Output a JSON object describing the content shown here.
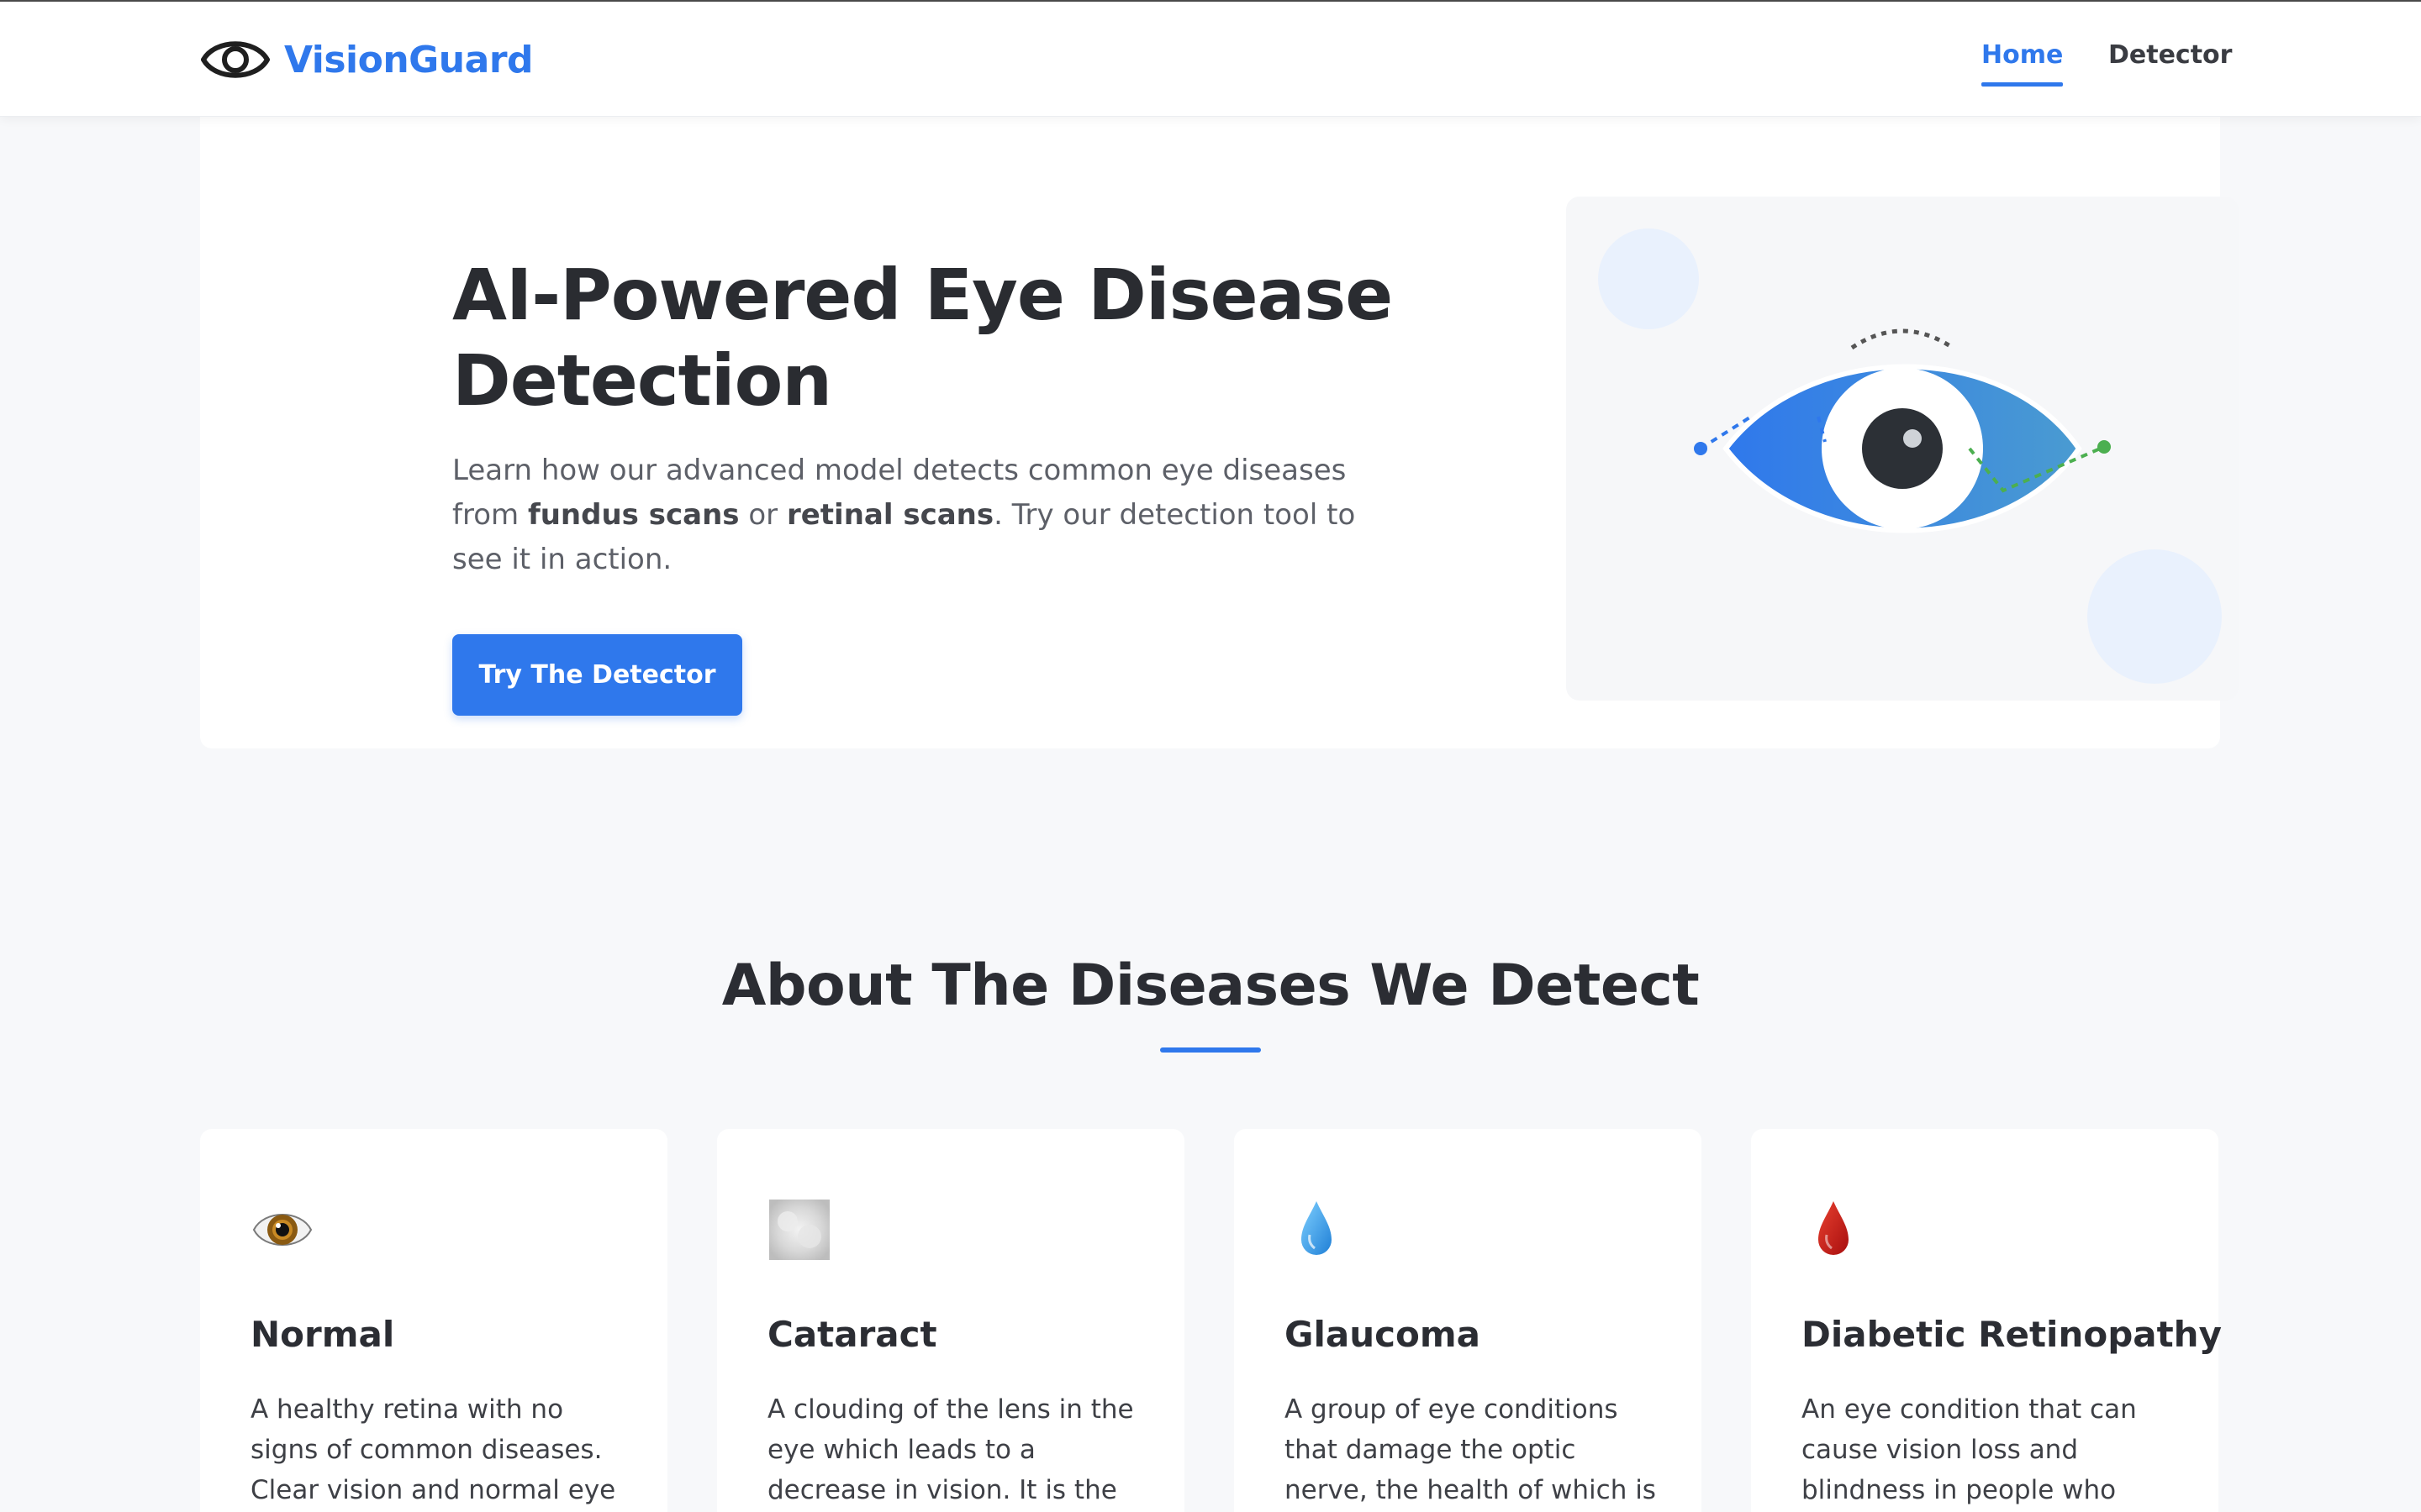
{
  "nav": {
    "brand": "VisionGuard",
    "links": [
      {
        "label": "Home",
        "active": true
      },
      {
        "label": "Detector",
        "active": false
      }
    ]
  },
  "hero": {
    "title_line1": "AI-Powered Eye Disease",
    "title_line2": "Detection",
    "desc_part1": "Learn how our advanced model detects common eye diseases from ",
    "desc_bold1": "fundus scans",
    "desc_part2": " or ",
    "desc_bold2": "retinal scans",
    "desc_part3": ". Try our detection tool to see it in action.",
    "cta_label": "Try The Detector"
  },
  "section": {
    "title": "About The Diseases We Detect"
  },
  "cards": [
    {
      "icon": "eye-icon",
      "title": "Normal",
      "desc": "A healthy retina with no signs of common diseases. Clear vision and normal eye"
    },
    {
      "icon": "cloud-blur-icon",
      "title": "Cataract",
      "desc": "A clouding of the lens in the eye which leads to a decrease in vision. It is the"
    },
    {
      "icon": "water-drop-icon",
      "title": "Glaucoma",
      "desc": "A group of eye conditions that damage the optic nerve, the health of which is"
    },
    {
      "icon": "blood-drop-icon",
      "title": "Diabetic Retinopathy",
      "desc": "An eye condition that can cause vision loss and blindness in people who"
    }
  ],
  "colors": {
    "accent": "#2f78ec",
    "background": "#f7f8fa",
    "card": "#ffffff",
    "text": "#2b2d33"
  }
}
